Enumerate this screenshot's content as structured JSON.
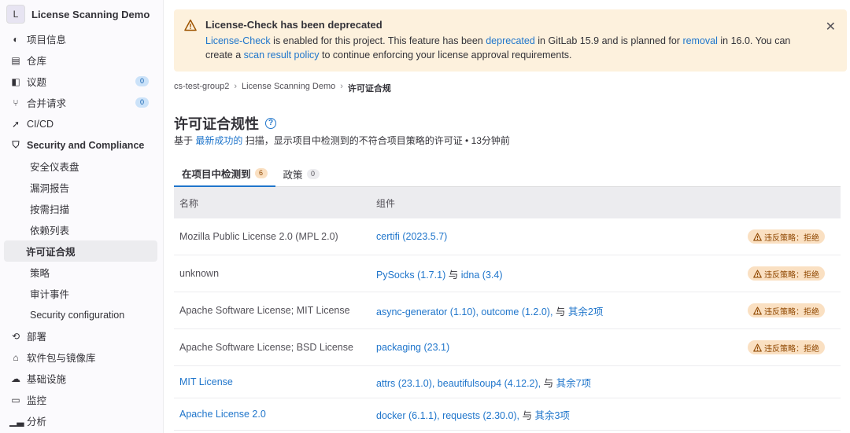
{
  "project": {
    "avatar": "L",
    "name": "License Scanning Demo"
  },
  "sidebar": {
    "items": [
      {
        "icon": "project-icon",
        "glyph": "◐",
        "label": "项目信息"
      },
      {
        "icon": "repository-icon",
        "glyph": "▤",
        "label": "仓库"
      },
      {
        "icon": "issues-icon",
        "glyph": "◧",
        "label": "议题",
        "badge": "0"
      },
      {
        "icon": "merge-request-icon",
        "glyph": "⑂",
        "label": "合并请求",
        "badge": "0"
      },
      {
        "icon": "rocket-icon",
        "glyph": "➚",
        "label": "CI/CD"
      },
      {
        "icon": "shield-icon",
        "glyph": "⛉",
        "label": "Security and Compliance"
      }
    ],
    "sub_items": [
      {
        "label": "安全仪表盘"
      },
      {
        "label": "漏洞报告"
      },
      {
        "label": "按需扫描"
      },
      {
        "label": "依赖列表"
      },
      {
        "label": "许可证合规"
      },
      {
        "label": "策略"
      },
      {
        "label": "审计事件"
      },
      {
        "label": "Security configuration"
      }
    ],
    "items_after": [
      {
        "icon": "deployments-icon",
        "glyph": "⟲",
        "label": "部署"
      },
      {
        "icon": "package-icon",
        "glyph": "⌂",
        "label": "软件包与镜像库"
      },
      {
        "icon": "cloud-gear-icon",
        "glyph": "☁",
        "label": "基础设施"
      },
      {
        "icon": "monitor-icon",
        "glyph": "▭",
        "label": "监控"
      },
      {
        "icon": "chart-icon",
        "glyph": "▁▃",
        "label": "分析"
      }
    ]
  },
  "alert": {
    "title": "License-Check has been deprecated",
    "body_1": "License-Check",
    "body_2": " is enabled for this project. This feature has been ",
    "body_3": "deprecated",
    "body_4": " in GitLab 15.9 and is planned for ",
    "body_5": "removal",
    "body_6": " in 16.0. You can create a ",
    "body_7": "scan result policy",
    "body_8": " to continue enforcing your license approval requirements."
  },
  "breadcrumb": {
    "group": "cs-test-group2",
    "project": "License Scanning Demo",
    "current": "许可证合规"
  },
  "page": {
    "title": "许可证合规性",
    "subtitle_1": "基于 ",
    "subtitle_link": "最新成功的",
    "subtitle_2": " 扫描，显示项目中检测到的不符合项目策略的许可证 • 13分钟前"
  },
  "tabs": [
    {
      "label": "在项目中检测到",
      "count": "6"
    },
    {
      "label": "政策",
      "count": "0"
    }
  ],
  "table": {
    "headers": [
      "名称",
      "组件"
    ],
    "rows": [
      {
        "name": "Mozilla Public License 2.0 (MPL 2.0)",
        "components": "certifi (2023.5.7)",
        "joiner": "",
        "extra": "",
        "status": "违反策略：拒绝"
      },
      {
        "name": "unknown",
        "components": "PySocks (1.7.1)",
        "joiner": " 与 ",
        "components_b": "idna (3.4)",
        "extra": "",
        "status": "违反策略：拒绝"
      },
      {
        "name": "Apache Software License; MIT License",
        "components": "async-generator (1.10), outcome (1.2.0),",
        "joiner": " 与 ",
        "extra": "其余2项",
        "status": "违反策略：拒绝"
      },
      {
        "name": "Apache Software License; BSD License",
        "components": "packaging (23.1)",
        "joiner": "",
        "extra": "",
        "status": "违反策略：拒绝"
      },
      {
        "name": "MIT License",
        "components": "attrs (23.1.0), beautifulsoup4 (4.12.2),",
        "joiner": " 与 ",
        "extra": "其余7项",
        "status": ""
      },
      {
        "name": "Apache License 2.0",
        "components": "docker (6.1.1), requests (2.30.0),",
        "joiner": " 与 ",
        "extra": "其余3项",
        "status": ""
      }
    ]
  },
  "colors": {
    "link": "#1f75cb",
    "alert_bg": "#fdf1dd",
    "warn_pill_bg": "#fae0c2",
    "warn_text": "#8f4700"
  }
}
